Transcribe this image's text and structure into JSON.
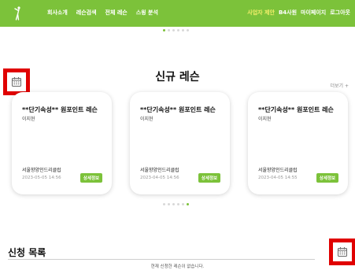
{
  "nav": {
    "left": [
      "회사소개",
      "레슨검색",
      "전체 레슨",
      "스윙 분석"
    ],
    "right": [
      "사업자 제안",
      "B4사원",
      "마이페이지",
      "로그아웃"
    ]
  },
  "new_lessons": {
    "title": "신규 레슨",
    "more": "더보기 +",
    "cards": [
      {
        "title": "**단기속성** 원포인트 레슨",
        "teacher": "이지현",
        "venue": "서울향양인드리클럽",
        "date": "2023-05-05 14:56",
        "button": "상세정보"
      },
      {
        "title": "**단기속성** 원포인트 레슨",
        "teacher": "이지현",
        "venue": "서울향양인드리클럽",
        "date": "2023-04-05 14:56",
        "button": "상세정보"
      },
      {
        "title": "**단기속성** 원포인트 레슨",
        "teacher": "이지현",
        "venue": "서울향양인드리클럽",
        "date": "2023-04-05 14:55",
        "button": "상세정보"
      }
    ]
  },
  "apply_list": {
    "title": "신청 목록",
    "empty": "현재 신청한 레슨이 없습니다."
  },
  "colors": {
    "brand": "#7cc23a",
    "highlight": "#f2ee6a",
    "annotation_border": "#e00000"
  }
}
